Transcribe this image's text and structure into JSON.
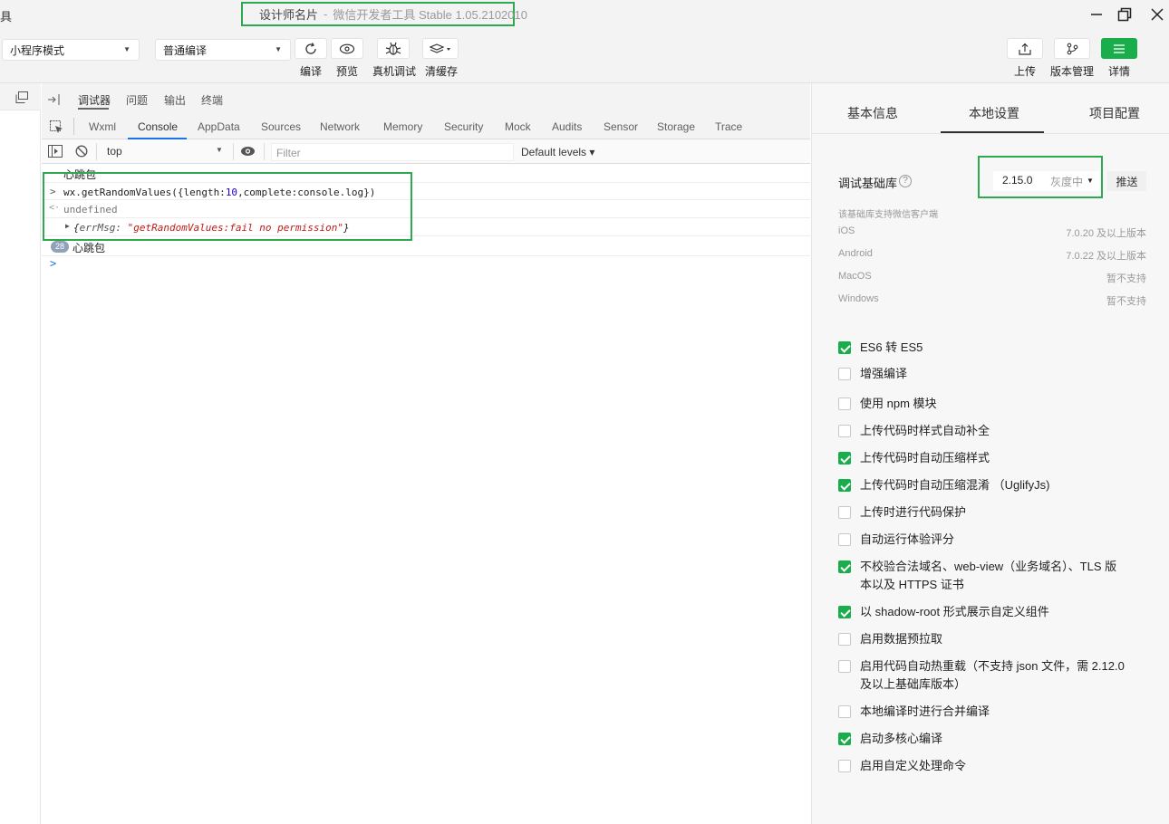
{
  "window": {
    "app_name_cut": "具",
    "project_name": "设计师名片",
    "separator": "-",
    "app_title": "微信开发者工具 Stable 1.05.2102010"
  },
  "toolbar": {
    "mode_select": "小程序模式",
    "compile_select": "普通编译",
    "buttons": [
      {
        "label": "编译",
        "icon": "refresh-icon"
      },
      {
        "label": "预览",
        "icon": "eye-icon"
      },
      {
        "label": "真机调试",
        "icon": "bug-icon"
      },
      {
        "label": "清缓存",
        "icon": "layers-icon"
      },
      {
        "label": "上传",
        "icon": "upload-icon"
      },
      {
        "label": "版本管理",
        "icon": "branch-icon"
      },
      {
        "label": "详情",
        "icon": "menu-icon"
      }
    ],
    "accent_color": "#19ad4b"
  },
  "devtools": {
    "tabs": [
      "调试器",
      "问题",
      "输出",
      "终端"
    ],
    "panels": [
      "Wxml",
      "Console",
      "AppData",
      "Sources",
      "Network",
      "Memory",
      "Security",
      "Mock",
      "Audits",
      "Sensor",
      "Storage",
      "Trace"
    ],
    "active_panel": "Console",
    "context": "top",
    "filter_placeholder": "Filter",
    "levels": "Default levels ▾"
  },
  "console": {
    "line_heartbeat_top": "心跳包",
    "input_prompt": ">",
    "input_fn": "wx.getRandomValues({length:",
    "input_num": "10",
    "input_rest": ",complete:console.log})",
    "result_prompt": "<·",
    "result": "undefined",
    "obj_open": "{",
    "obj_key": "errMsg:",
    "obj_value": "\"getRandomValues:fail no permission\"",
    "obj_close": "}",
    "repeat_count": "28",
    "heartbeat": "心跳包",
    "caret": ">"
  },
  "settings": {
    "tabs": [
      "基本信息",
      "本地设置",
      "项目配置"
    ],
    "active_tab": "本地设置",
    "base_lib_label": "调试基础库",
    "base_lib_version": "2.15.0",
    "base_lib_status": "灰度中",
    "push_button": "推送",
    "support_title": "该基础库支持微信客户端",
    "support": [
      {
        "platform": "iOS",
        "value": "7.0.20 及以上版本"
      },
      {
        "platform": "Android",
        "value": "7.0.22 及以上版本"
      },
      {
        "platform": "MacOS",
        "value": "暂不支持"
      },
      {
        "platform": "Windows",
        "value": "暂不支持"
      }
    ],
    "options": [
      {
        "label": "ES6 转 ES5",
        "checked": true
      },
      {
        "label": "增强编译",
        "checked": false
      },
      {
        "label": "使用 npm 模块",
        "checked": false
      },
      {
        "label": "上传代码时样式自动补全",
        "checked": false
      },
      {
        "label": "上传代码时自动压缩样式",
        "checked": true
      },
      {
        "label": "上传代码时自动压缩混淆 （UglifyJs)",
        "checked": true
      },
      {
        "label": "上传时进行代码保护",
        "checked": false
      },
      {
        "label": "自动运行体验评分",
        "checked": false
      },
      {
        "label": "不校验合法域名、web-view（业务域名）、TLS 版本以及 HTTPS 证书",
        "checked": true
      },
      {
        "label": "以 shadow-root 形式展示自定义组件",
        "checked": true
      },
      {
        "label": "启用数据预拉取",
        "checked": false
      },
      {
        "label": "启用代码自动热重载（不支持 json 文件，需 2.12.0 及以上基础库版本）",
        "checked": false
      },
      {
        "label": "本地编译时进行合并编译",
        "checked": false
      },
      {
        "label": "启动多核心编译",
        "checked": true
      },
      {
        "label": "启用自定义处理命令",
        "checked": false
      }
    ]
  }
}
